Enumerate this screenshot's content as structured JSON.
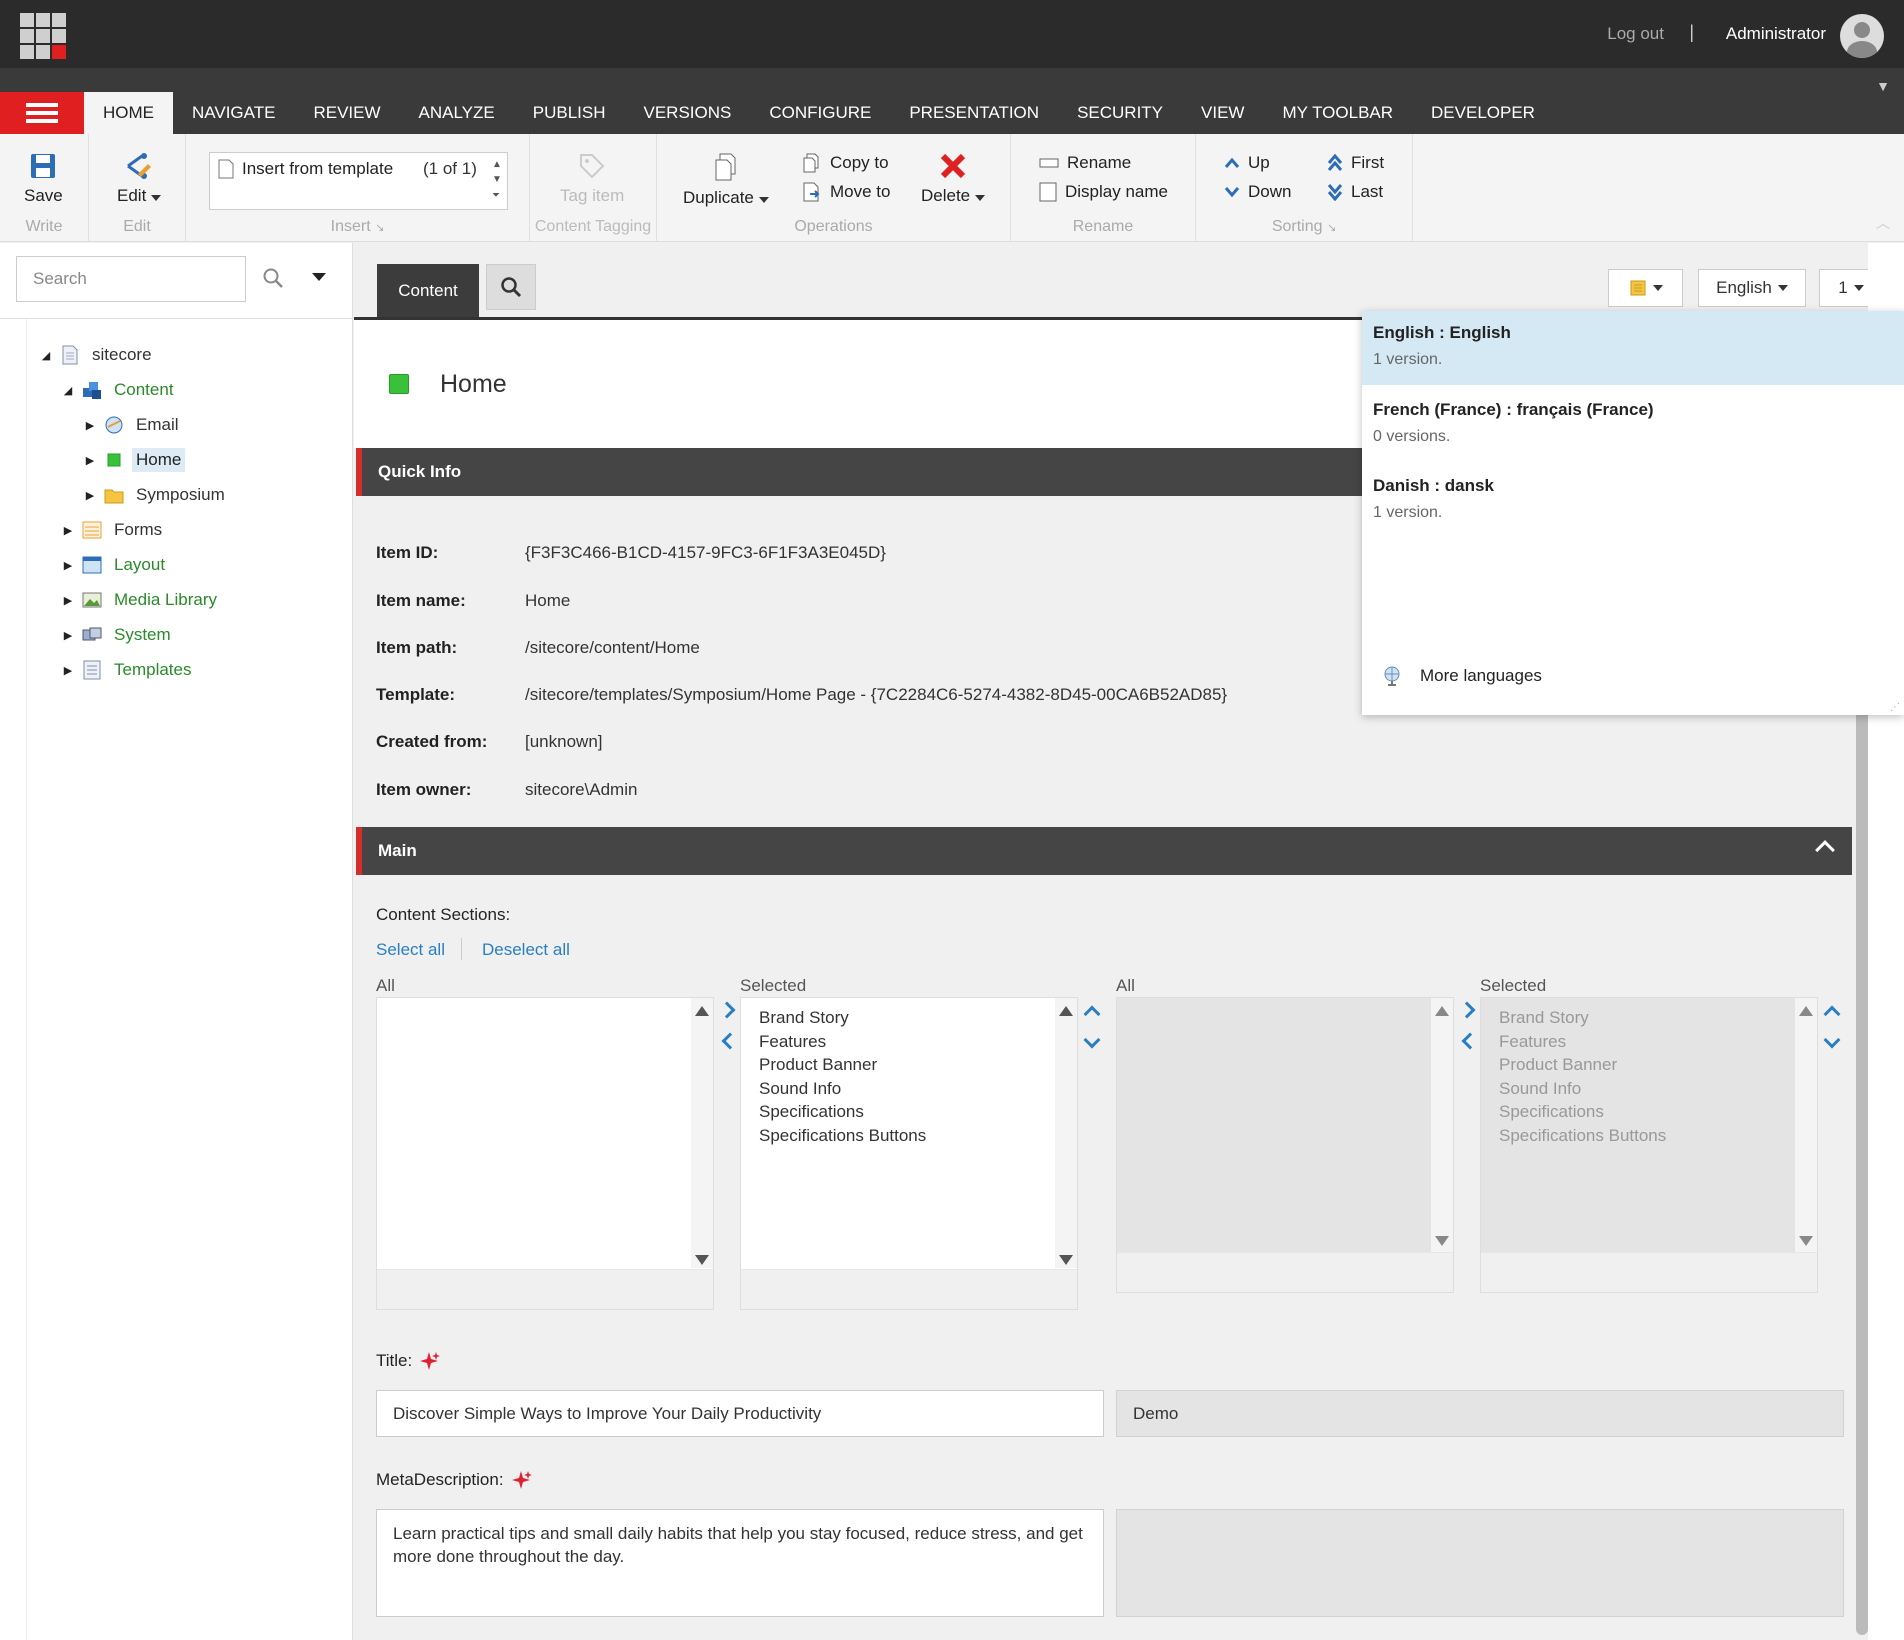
{
  "header": {
    "logout": "Log out",
    "separator": "|",
    "user": "Administrator"
  },
  "ribbon_tabs": [
    "HOME",
    "NAVIGATE",
    "REVIEW",
    "ANALYZE",
    "PUBLISH",
    "VERSIONS",
    "CONFIGURE",
    "PRESENTATION",
    "SECURITY",
    "VIEW",
    "MY TOOLBAR",
    "DEVELOPER"
  ],
  "ribbon": {
    "write": {
      "save": "Save",
      "label": "Write"
    },
    "edit": {
      "edit": "Edit",
      "label": "Edit"
    },
    "insert": {
      "item": "Insert from template",
      "count": "(1 of 1)",
      "label": "Insert"
    },
    "tagging": {
      "tag": "Tag item",
      "label": "Content Tagging"
    },
    "operations": {
      "duplicate": "Duplicate",
      "copy": "Copy to",
      "move": "Move to",
      "delete": "Delete",
      "label": "Operations"
    },
    "rename": {
      "rename": "Rename",
      "display": "Display name",
      "label": "Rename"
    },
    "sorting": {
      "up": "Up",
      "down": "Down",
      "first": "First",
      "last": "Last",
      "label": "Sorting"
    }
  },
  "search": {
    "placeholder": "Search"
  },
  "tree": [
    {
      "label": "sitecore"
    },
    {
      "label": "Content"
    },
    {
      "label": "Email"
    },
    {
      "label": "Home"
    },
    {
      "label": "Symposium"
    },
    {
      "label": "Forms"
    },
    {
      "label": "Layout"
    },
    {
      "label": "Media Library"
    },
    {
      "label": "System"
    },
    {
      "label": "Templates"
    }
  ],
  "editor": {
    "content_tab": "Content",
    "language": "English",
    "version": "1",
    "item_title": "Home"
  },
  "quick_info": {
    "header": "Quick Info",
    "rows": [
      {
        "label": "Item ID:",
        "value": "{F3F3C466-B1CD-4157-9FC3-6F1F3A3E045D}"
      },
      {
        "label": "Item name:",
        "value": "Home"
      },
      {
        "label": "Item path:",
        "value": "/sitecore/content/Home"
      },
      {
        "label": "Template:",
        "value": "/sitecore/templates/Symposium/Home Page - {7C2284C6-5274-4382-8D45-00CA6B52AD85}"
      },
      {
        "label": "Created from:",
        "value": "[unknown]"
      },
      {
        "label": "Item owner:",
        "value": "sitecore\\Admin"
      }
    ]
  },
  "main": {
    "header": "Main",
    "content_sections": "Content Sections:",
    "select_all": "Select all",
    "deselect_all": "Deselect all",
    "all_label": "All",
    "selected_label": "Selected",
    "selected_items": [
      "Brand Story",
      "Features",
      "Product Banner",
      "Sound Info",
      "Specifications",
      "Specifications Buttons"
    ],
    "title_label": "Title:",
    "title_value": "Discover Simple Ways to Improve Your Daily Productivity",
    "title_original": "Demo",
    "meta_label": "MetaDescription:",
    "meta_value": "Learn practical tips and small daily habits that help you stay focused, reduce stress, and get more done throughout the day."
  },
  "language_menu": {
    "items": [
      {
        "name": "English : English",
        "versions": "1 version."
      },
      {
        "name": "French (France) : français (France)",
        "versions": "0 versions."
      },
      {
        "name": "Danish : dansk",
        "versions": "1 version."
      }
    ],
    "more": "More languages"
  },
  "colors": {
    "accent_red": "#e02020",
    "link_blue": "#2a7fc1",
    "tree_green": "#2a8a2a",
    "dark_bar": "#2b2b2b"
  }
}
